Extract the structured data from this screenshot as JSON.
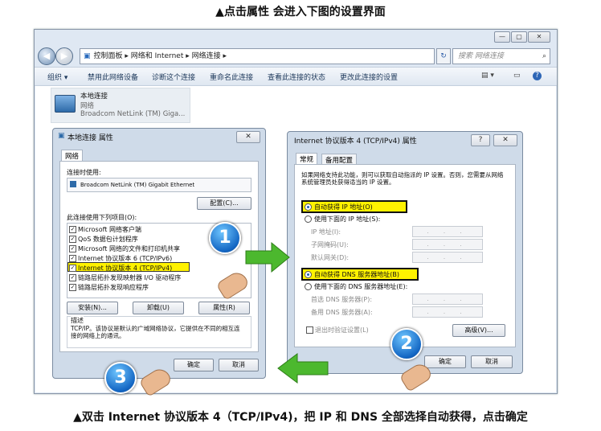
{
  "captions": {
    "top": "▲点击属性 会进入下图的设置界面",
    "bottom": "▲双击 Internet 协议版本 4（TCP/IPv4)，把 IP 和 DNS 全部选择自动获得，点击确定"
  },
  "explorer": {
    "window_controls": [
      "—",
      "▢",
      "✕"
    ],
    "breadcrumb": "控制面板 ▸ 网络和 Internet ▸ 网络连接 ▸",
    "search_placeholder": "搜索 网络连接",
    "toolbar": [
      "组织 ▾",
      "禁用此网络设备",
      "诊断这个连接",
      "重命名此连接",
      "查看此连接的状态",
      "更改此连接的设置"
    ],
    "adapter": {
      "name": "本地连接",
      "status": "网络",
      "device": "Broadcom NetLink (TM) Giga..."
    }
  },
  "props_dialog": {
    "title": "本地连接 属性",
    "close": "✕",
    "tab": "网络",
    "connect_using_label": "连接时使用:",
    "adapter_name": "Broadcom NetLink (TM) Gigabit Ethernet",
    "configure_button": "配置(C)...",
    "items_label": "此连接使用下列项目(O):",
    "items": [
      "Microsoft 网络客户端",
      "QoS 数据包计划程序",
      "Microsoft 网络的文件和打印机共享",
      "Internet 协议版本 6 (TCP/IPv6)",
      "Internet 协议版本 4 (TCP/IPv4)",
      "链路层拓扑发现映射器 I/O 驱动程序",
      "链路层拓扑发现响应程序"
    ],
    "install_button": "安装(N)...",
    "uninstall_button": "卸载(U)",
    "properties_button": "属性(R)",
    "description_label": "描述",
    "description_text": "TCP/IP。该协议是默认的广域网络协议，它提供在不同的相互连接的网络上的通讯。",
    "ok_button": "确定",
    "cancel_button": "取消"
  },
  "ipv4_dialog": {
    "title": "Internet 协议版本 4 (TCP/IPv4) 属性",
    "help": "?",
    "close": "✕",
    "tabs": [
      "常规",
      "备用配置"
    ],
    "intro": "如果网络支持此功能，则可以获取自动指派的 IP 设置。否则，您需要从网络系统管理员处获得适当的 IP 设置。",
    "auto_ip": "自动获得 IP 地址(O)",
    "manual_ip": "使用下面的 IP 地址(S):",
    "ip_address": "IP 地址(I):",
    "subnet": "子网掩码(U):",
    "gateway": "默认网关(D):",
    "auto_dns": "自动获得 DNS 服务器地址(B)",
    "manual_dns": "使用下面的 DNS 服务器地址(E):",
    "preferred_dns": "首选 DNS 服务器(P):",
    "alternate_dns": "备用 DNS 服务器(A):",
    "validate_on_exit": "退出时验证设置(L)",
    "advanced_button": "高级(V)...",
    "ok_button": "确定",
    "cancel_button": "取消",
    "ip_placeholder": ". . ."
  },
  "steps": [
    "1",
    "2",
    "3"
  ],
  "colors": {
    "highlight": "#fff200",
    "badge": "#1467c4",
    "arrow": "#4cb82e"
  }
}
